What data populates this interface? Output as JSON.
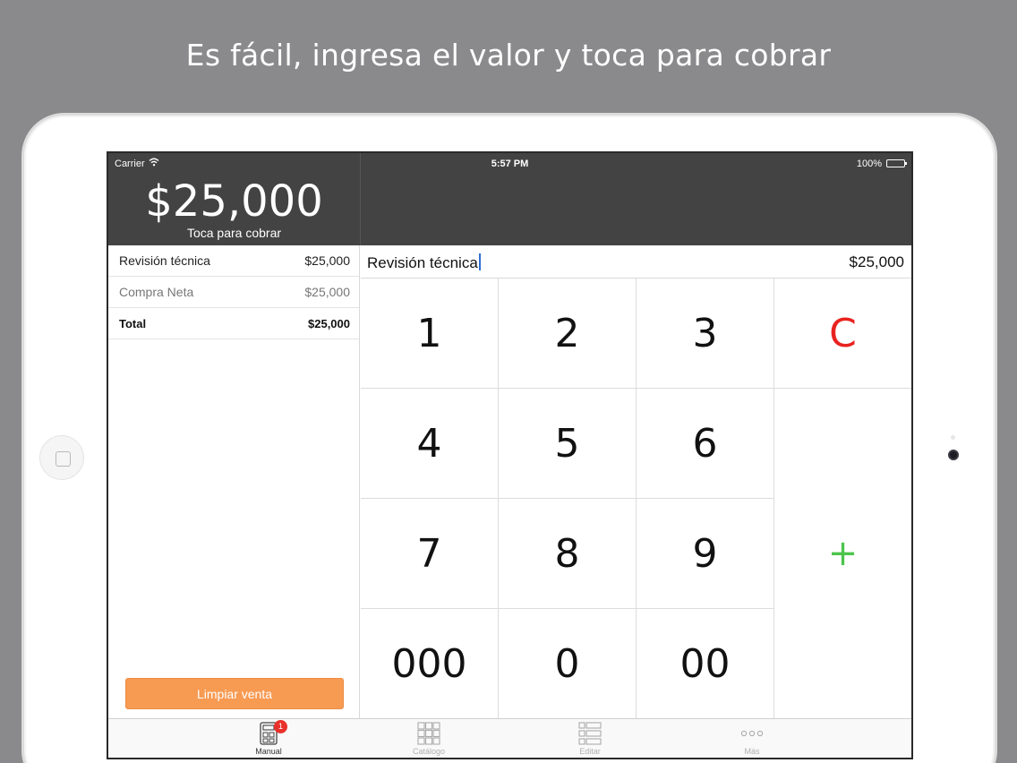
{
  "headline": "Es fácil, ingresa el valor y toca para cobrar",
  "status_bar": {
    "carrier": "Carrier",
    "time": "5:57 PM",
    "battery": "100%"
  },
  "sale": {
    "total": "$25,000",
    "caption": "Toca para cobrar"
  },
  "items": [
    {
      "name": "Revisión técnica",
      "price": "$25,000"
    },
    {
      "name": "Compra Neta",
      "price": "$25,000"
    },
    {
      "name": "Total",
      "price": "$25,000"
    }
  ],
  "clear_sale_label": "Limpiar venta",
  "entry": {
    "name": "Revisión técnica",
    "amount": "$25,000"
  },
  "keypad": {
    "k1": "1",
    "k2": "2",
    "k3": "3",
    "clear": "C",
    "k4": "4",
    "k5": "5",
    "k6": "6",
    "k7": "7",
    "k8": "8",
    "k9": "9",
    "plus": "+",
    "k000": "000",
    "k0": "0",
    "k00": "00"
  },
  "tabs": [
    {
      "label": "Manual",
      "badge": "1"
    },
    {
      "label": "Catálogo"
    },
    {
      "label": "Editar"
    },
    {
      "label": "Más"
    }
  ],
  "colors": {
    "background": "#8a8a8c",
    "header": "#434343",
    "accent_orange": "#f79a52",
    "clear_red": "#e8231f",
    "plus_green": "#4cc54c",
    "badge_red": "#e8322b"
  }
}
